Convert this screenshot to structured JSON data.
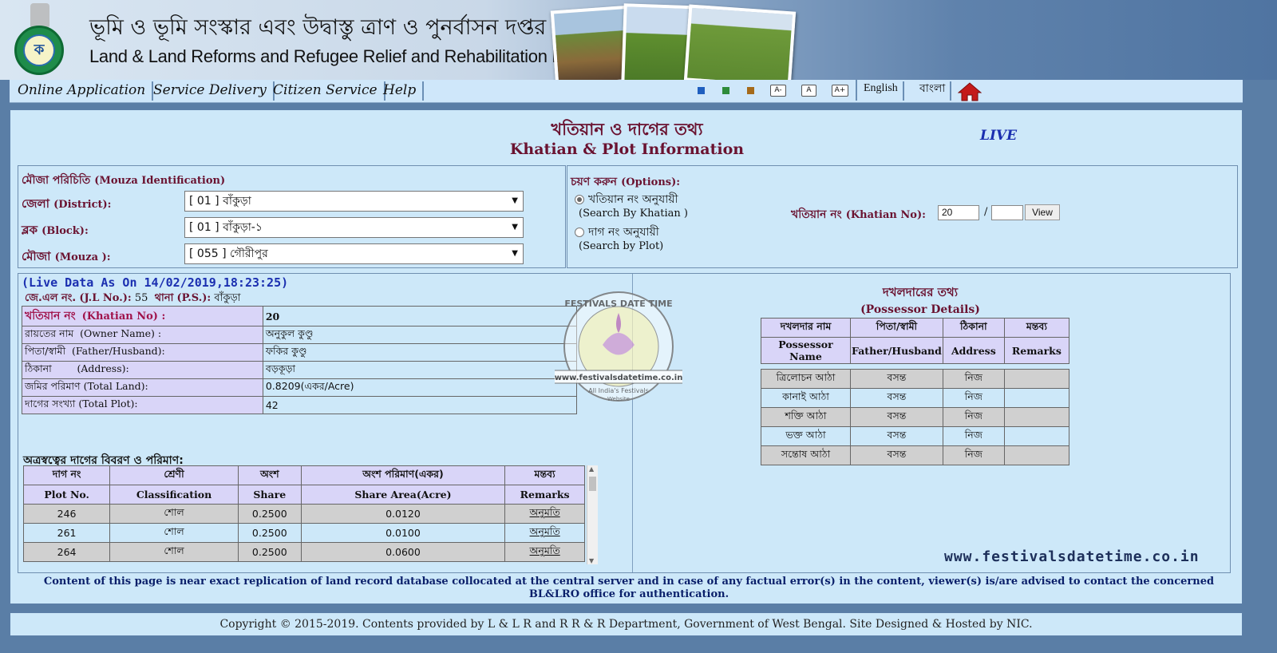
{
  "header": {
    "dept_bn": "ভূমি ও ভূমি সংস্কার এবং উদ্বাস্তু ত্রাণ ও পুনর্বাসন দপ্তর",
    "dept_en": "Land & Land Reforms and Refugee Relief and Rehabilitation Department"
  },
  "menu": {
    "items": [
      "Online Application",
      "Service Delivery",
      "Citizen Service",
      "Help"
    ],
    "theme_colors": [
      "#1f5fbf",
      "#2e8b3a",
      "#a56a1a"
    ],
    "font_buttons": [
      "A-",
      "A",
      "A+"
    ],
    "languages": [
      "English",
      "বাংলা"
    ],
    "home_icon": "home-icon"
  },
  "page": {
    "title_bn": "খতিয়ান ও দাগের তথ্য",
    "title_en": "Khatian & Plot Information",
    "status": "LIVE"
  },
  "mouza": {
    "heading_bn": "মৌজা পরিচিতি",
    "heading_en": "(Mouza Identification)",
    "district_bn": "জেলা",
    "district_en": "(District):",
    "district_value": "[ 01 ] বাঁকুড়া",
    "block_bn": "ব্লক",
    "block_en": "(Block):",
    "block_value": "[ 01 ] বাঁকুড়া-১",
    "mouza_bn": "মৌজা",
    "mouza_en": "(Mouza ):",
    "mouza_value": "[ 055 ] গৌরীপুর"
  },
  "options": {
    "heading_bn": "চয়ণ করুন",
    "heading_en": "(Options):",
    "by_khatian_bn": "খতিয়ান নং অনুযায়ী",
    "by_khatian_en": "(Search By Khatian )",
    "by_plot_bn": "দাগ নং অনুযায়ী",
    "by_plot_en": "(Search by Plot)",
    "khatian_label_bn": "খতিয়ান নং",
    "khatian_label_en": "(Khatian No):",
    "khatian_value": "20",
    "separator": "/",
    "khatian_sub_value": "",
    "view_button": "View"
  },
  "live_data": {
    "timestamp": "(Live Data As On 14/02/2019,18:23:25)",
    "jl_bn": "জে.এল নং.",
    "jl_en": "(J.L No.):",
    "jl_value": "55",
    "ps_bn": "থানা",
    "ps_en": "(P.S.):",
    "ps_value": "বাঁকুড়া"
  },
  "khatian_info": {
    "khatian_bn": "খতিয়ান নং",
    "khatian_en": "(Khatian No) :",
    "khatian_value": "20",
    "rows": [
      {
        "bn": "রায়তের নাম",
        "en": "(Owner Name) :",
        "value": "অনুকুল কুণ্ডু"
      },
      {
        "bn": "পিতা/স্বামী",
        "en": "(Father/Husband):",
        "value": "ফকির কুণ্ডু"
      },
      {
        "bn": "ঠিকানা",
        "en": "(Address):",
        "value": "বড়কূড়া"
      },
      {
        "bn": "জমির পরিমাণ",
        "en": "(Total Land):",
        "value": "0.8209(একর/Acre)"
      },
      {
        "bn": "দাগের সংখ্যা",
        "en": "(Total Plot):",
        "value": "42"
      }
    ]
  },
  "plots": {
    "heading": "অত্রস্বত্বের দাগের বিবরণ ও পরিমাণ:",
    "headers_bn": [
      "দাগ নং",
      "শ্রেণী",
      "অংশ",
      "অংশ পরিমাণ(একর)",
      "মন্তব্য"
    ],
    "headers_en": [
      "Plot No.",
      "Classification",
      "Share",
      "Share Area(Acre)",
      "Remarks"
    ],
    "rows": [
      [
        "246",
        "শোল",
        "0.2500",
        "0.0120",
        "অনুমতি"
      ],
      [
        "261",
        "শোল",
        "0.2500",
        "0.0100",
        "অনুমতি"
      ],
      [
        "264",
        "শোল",
        "0.2500",
        "0.0600",
        "অনুমতি"
      ]
    ]
  },
  "possessor": {
    "heading_bn": "দখলদারের তথ্য",
    "heading_en": "(Possessor Details)",
    "headers_bn": [
      "দখলদার নাম",
      "পিতা/স্বামী",
      "ঠিকানা",
      "মন্তব্য"
    ],
    "headers_en": [
      "Possessor Name",
      "Father/Husband",
      "Address",
      "Remarks"
    ],
    "rows": [
      [
        "ত্রিলোচন আঠা",
        "বসন্ত",
        "নিজ",
        ""
      ],
      [
        "কানাই আঠা",
        "বসন্ত",
        "নিজ",
        ""
      ],
      [
        "শক্তি আঠা",
        "বসন্ত",
        "নিজ",
        ""
      ],
      [
        "ভক্ত আঠা",
        "বসন্ত",
        "নিজ",
        ""
      ],
      [
        "সন্তোষ আঠা",
        "বসন্ত",
        "নিজ",
        ""
      ]
    ]
  },
  "watermark": {
    "top": "FESTIVALS DATE TIME",
    "url": "www.festivalsdatetime.co.in",
    "tagline1": "All India's Festivals",
    "tagline2": "Website"
  },
  "site_url": "www.festivalsdatetime.co.in",
  "footnote": "Content of this page is near exact replication of land record database collocated at the central server and in case of any factual error(s) in the content, viewer(s) is/are advised to contact the concerned BL&LRO office for authentication.",
  "copyright": "Copyright © 2015-2019. Contents provided by L & L R and R R & R Department, Government of West Bengal. Site Designed & Hosted by NIC."
}
